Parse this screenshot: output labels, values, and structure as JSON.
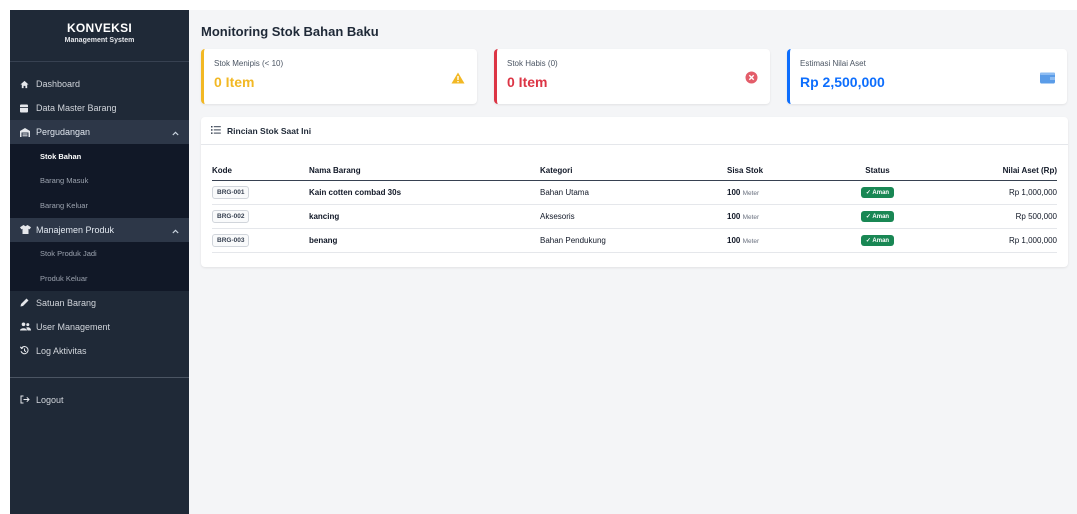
{
  "sidebar": {
    "brand_title": "KONVEKSI",
    "brand_subtitle": "Management System",
    "items": {
      "dashboard": "Dashboard",
      "master": "Data Master Barang",
      "pergudangan": "Pergudangan",
      "stok_bahan": "Stok Bahan",
      "barang_masuk": "Barang Masuk",
      "barang_keluar": "Barang Keluar",
      "manajemen_produk": "Manajemen Produk",
      "stok_produk_jadi": "Stok Produk Jadi",
      "produk_keluar": "Produk Keluar",
      "satuan_barang": "Satuan Barang",
      "user_management": "User Management",
      "log_aktivitas": "Log Aktivitas",
      "logout": "Logout"
    }
  },
  "page": {
    "title": "Monitoring Stok Bahan Baku"
  },
  "cards": {
    "menipis": {
      "label": "Stok Menipis (< 10)",
      "value": "0 Item",
      "color": "#f2b824"
    },
    "habis": {
      "label": "Stok Habis (0)",
      "value": "0 Item",
      "color": "#dc3545"
    },
    "aset": {
      "label": "Estimasi Nilai Aset",
      "value": "Rp 2,500,000",
      "color": "#0d6efd"
    }
  },
  "table": {
    "title": "Rincian Stok Saat Ini",
    "headers": {
      "kode": "Kode",
      "nama": "Nama Barang",
      "kategori": "Kategori",
      "sisa": "Sisa Stok",
      "status": "Status",
      "nilai": "Nilai Aset (Rp)"
    },
    "rows": [
      {
        "kode": "BRG-001",
        "nama": "Kain cotten combad 30s",
        "kategori": "Bahan Utama",
        "qty": "100",
        "unit": "Meter",
        "status": "Aman",
        "nilai": "Rp 1,000,000"
      },
      {
        "kode": "BRG-002",
        "nama": "kancing",
        "kategori": "Aksesoris",
        "qty": "100",
        "unit": "Meter",
        "status": "Aman",
        "nilai": "Rp 500,000"
      },
      {
        "kode": "BRG-003",
        "nama": "benang",
        "kategori": "Bahan Pendukung",
        "qty": "100",
        "unit": "Meter",
        "status": "Aman",
        "nilai": "Rp 1,000,000"
      }
    ]
  }
}
